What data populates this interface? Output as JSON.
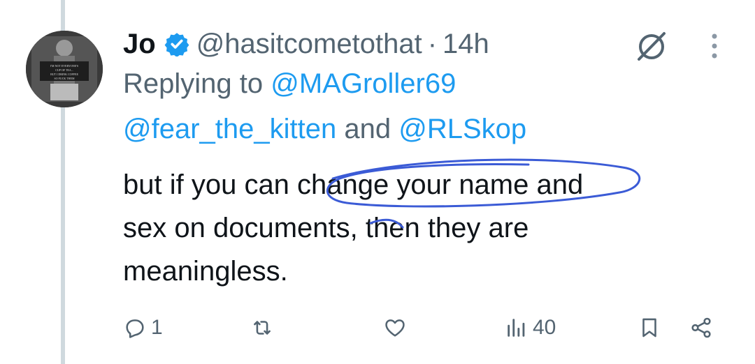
{
  "tweet": {
    "author_name": "Jo",
    "handle": "@hasitcometothat",
    "separator": "·",
    "time": "14h",
    "reply_prefix": "Replying to",
    "reply_mention_1": "@MAGroller69",
    "reply_mention_2": "@fear_the_kitten",
    "reply_and": "and",
    "reply_mention_3": "@RLSkop",
    "body_line_1": "but if you can change your name and",
    "body_line_2": "sex on documents, then they are",
    "body_line_3": "meaningless.",
    "avatar_text": "I'M NOT EVERYONE'S CUP OF TEA... BUT I DRINK COFFEE SO FUCK THEM",
    "stats": {
      "replies": "1",
      "views": "40"
    }
  },
  "colors": {
    "accent": "#1d9bf0",
    "secondary_text": "#536471",
    "thread_line": "#cfd9de",
    "scribble": "#3b5bd6"
  },
  "icons": [
    "verified-badge-icon",
    "grok-icon",
    "more-icon",
    "reply-icon",
    "retweet-icon",
    "like-icon",
    "views-icon",
    "bookmark-icon",
    "share-icon"
  ]
}
